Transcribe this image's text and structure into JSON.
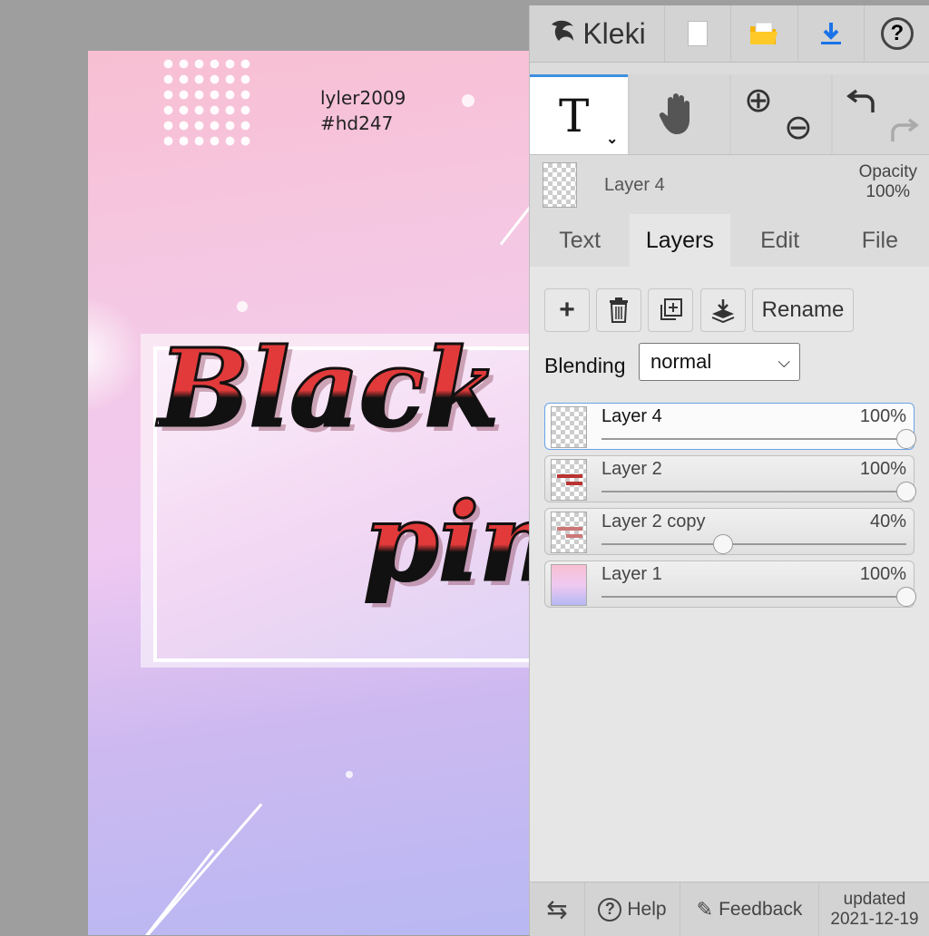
{
  "app": {
    "logo": "Kleki"
  },
  "canvas": {
    "credit_line1": "lyler2009",
    "credit_line2": "#hd247",
    "art_word1": "Black",
    "art_word2": "pink"
  },
  "toolbar": {
    "new_icon": "new-file-icon",
    "open_icon": "folder-icon",
    "save_icon": "download-icon",
    "help_icon": "help-icon",
    "colors": {
      "folder": "#f5b400",
      "download": "#1a73e8",
      "active_tab": "#3d8fe0"
    }
  },
  "tools": {
    "text_glyph": "T",
    "hand_icon": "hand-icon",
    "zoom_in": "⊕",
    "zoom_out": "⊖"
  },
  "layer_info": {
    "name": "Layer 4",
    "opacity_label": "Opacity",
    "opacity_value": "100%"
  },
  "tabs": [
    {
      "label": "Text"
    },
    {
      "label": "Layers"
    },
    {
      "label": "Edit"
    },
    {
      "label": "File"
    }
  ],
  "layer_tools": {
    "rename_label": "Rename"
  },
  "blending": {
    "label": "Blending",
    "value": "normal"
  },
  "layers": [
    {
      "name": "Layer 4",
      "opacity": "100%",
      "opacity_fraction": 1.0,
      "active": true
    },
    {
      "name": "Layer 2",
      "opacity": "100%",
      "opacity_fraction": 1.0,
      "active": false
    },
    {
      "name": "Layer 2 copy",
      "opacity": "40%",
      "opacity_fraction": 0.4,
      "active": false
    },
    {
      "name": "Layer 1",
      "opacity": "100%",
      "opacity_fraction": 1.0,
      "active": false
    }
  ],
  "footer": {
    "help_label": "Help",
    "feedback_label": "Feedback",
    "updated_line1": "updated",
    "updated_line2": "2021-12-19"
  }
}
